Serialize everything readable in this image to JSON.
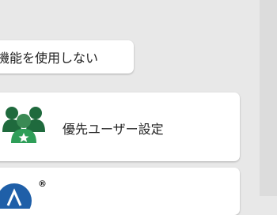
{
  "menu": {
    "items": [
      {
        "label": "機能を使用しない",
        "icon": "none"
      },
      {
        "label": "優先ユーザー設定",
        "icon": "priority-users-group-icon"
      },
      {
        "label": "",
        "icon": "brand-logo",
        "mark": "®"
      }
    ]
  },
  "colors": {
    "background": "#e8e8e8",
    "card": "#ffffff",
    "group_icon_dark": "#1f6a3d",
    "group_icon_mid": "#3a8a54",
    "group_icon_light": "#2e9e58",
    "logo_blue": "#1f5fa8"
  }
}
